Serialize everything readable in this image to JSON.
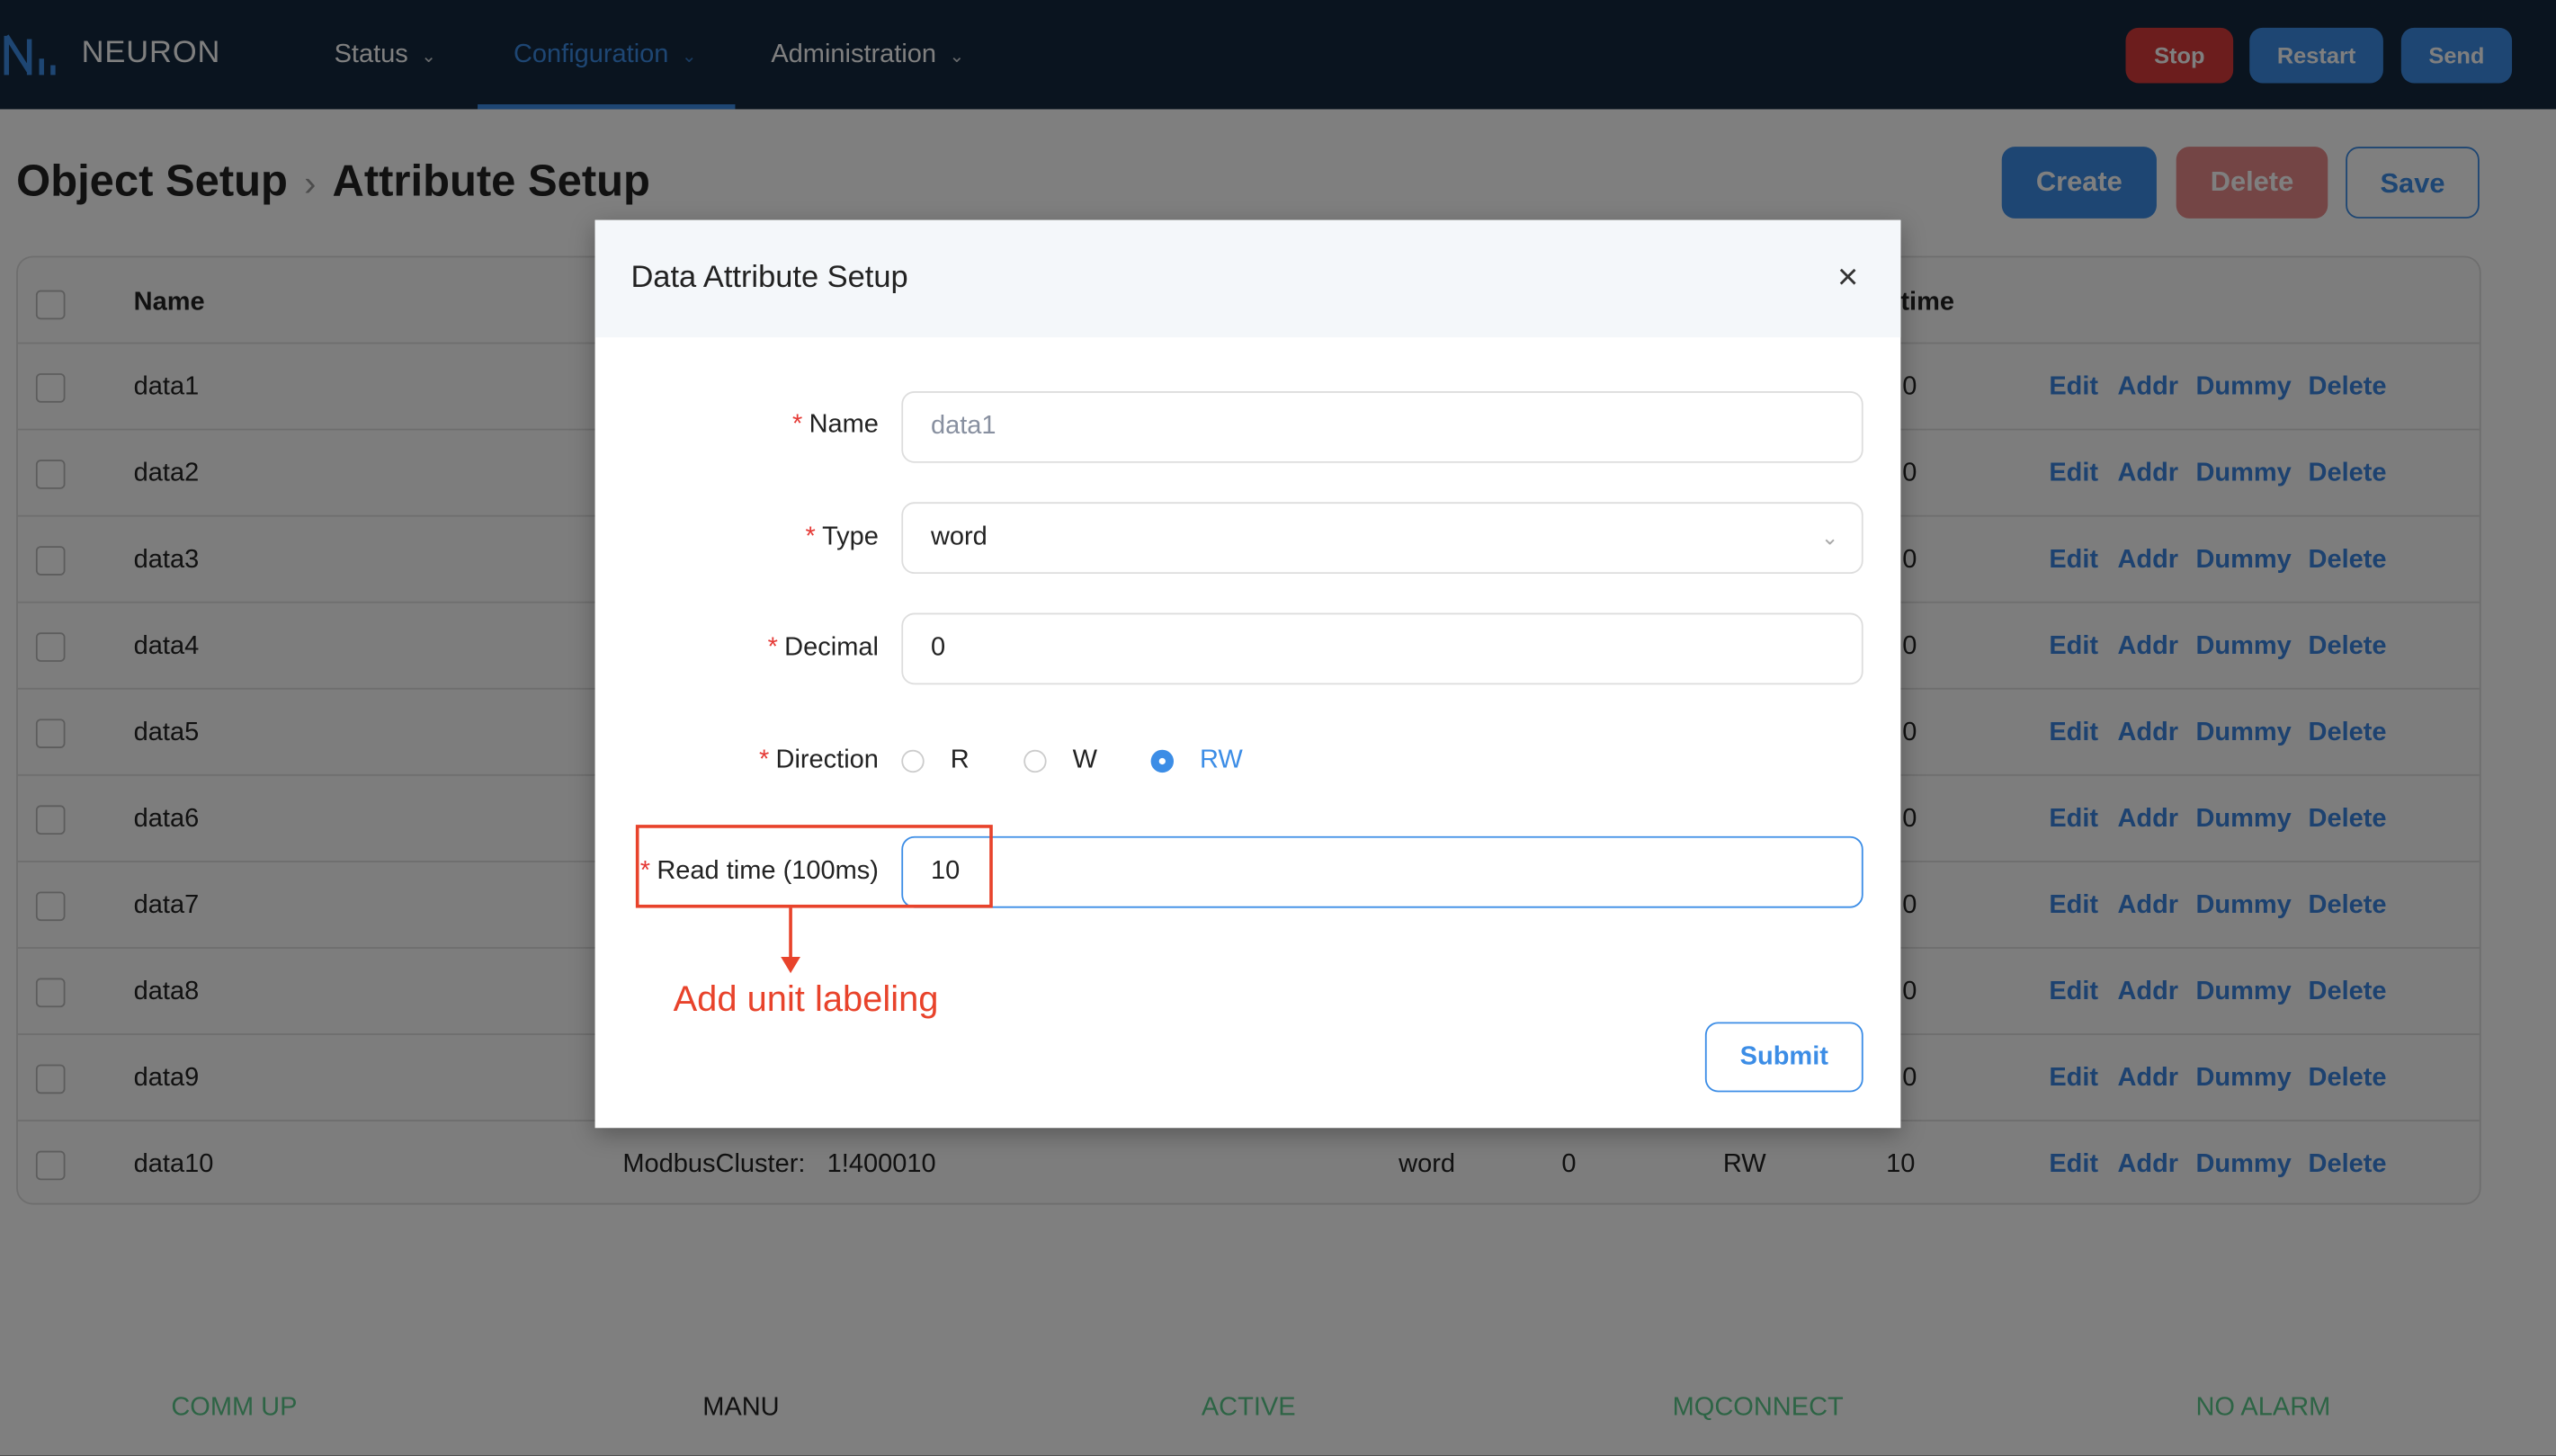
{
  "header": {
    "brand": "NEURON",
    "nav": [
      {
        "label": "Status",
        "active": false
      },
      {
        "label": "Configuration",
        "active": true
      },
      {
        "label": "Administration",
        "active": false
      }
    ],
    "chevron": "⌄",
    "buttons": {
      "stop": "Stop",
      "restart": "Restart",
      "send": "Send"
    }
  },
  "breadcrumb": {
    "parent": "Object Setup",
    "separator": "›",
    "current": "Attribute Setup"
  },
  "actions": {
    "create": "Create",
    "delete": "Delete",
    "save": "Save"
  },
  "table": {
    "headers": {
      "name": "Name",
      "time_partial": "time"
    },
    "rows": [
      {
        "name": "data1",
        "time_partial": "0"
      },
      {
        "name": "data2",
        "time_partial": "0"
      },
      {
        "name": "data3",
        "time_partial": "0"
      },
      {
        "name": "data4",
        "time_partial": "0"
      },
      {
        "name": "data5",
        "time_partial": "0"
      },
      {
        "name": "data6",
        "time_partial": "0"
      },
      {
        "name": "data7",
        "time_partial": "0"
      },
      {
        "name": "data8",
        "time_partial": "0"
      },
      {
        "name": "data9",
        "time_partial": "0"
      },
      {
        "name": "data10",
        "address": "ModbusCluster:   1!400010",
        "type": "word",
        "decimal": "0",
        "direction": "RW",
        "time_partial": "10"
      }
    ],
    "row_actions": {
      "edit": "Edit",
      "addr": "Addr",
      "dummy": "Dummy",
      "delete": "Delete"
    }
  },
  "footer": {
    "comm": "COMM UP",
    "mode": "MANU",
    "state": "ACTIVE",
    "mq": "MQCONNECT",
    "alarm": "NO ALARM"
  },
  "modal": {
    "title": "Data Attribute Setup",
    "close": "×",
    "required_mark": "*",
    "fields": {
      "name": {
        "label": "Name",
        "placeholder": "data1"
      },
      "type": {
        "label": "Type",
        "value": "word"
      },
      "decimal": {
        "label": "Decimal",
        "value": "0"
      },
      "direction": {
        "label": "Direction",
        "options": [
          "R",
          "W",
          "RW"
        ],
        "selected": "RW"
      },
      "read_time": {
        "label": "Read time (100ms)",
        "value": "10"
      }
    },
    "submit": "Submit"
  },
  "annotation": {
    "text": "Add unit labeling",
    "color": "#e8432b"
  },
  "colors": {
    "accent": "#3c8de6",
    "danger": "#d83a3a",
    "status_ok": "#5bc98a"
  }
}
